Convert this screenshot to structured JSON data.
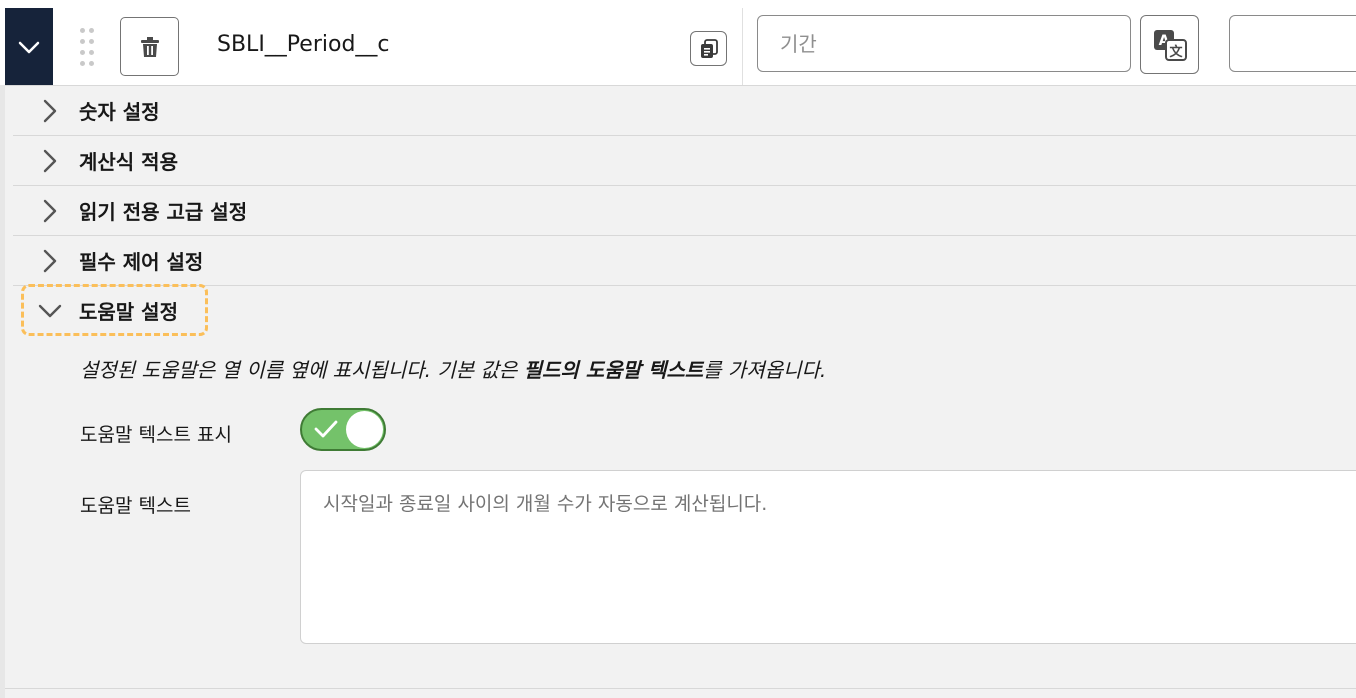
{
  "field": {
    "api_name": "SBLI__Period__c",
    "label_placeholder": "기간"
  },
  "sections": [
    {
      "title": "숫자 설정",
      "expanded": false
    },
    {
      "title": "계산식 적용",
      "expanded": false
    },
    {
      "title": "읽기 전용 고급 설정",
      "expanded": false
    },
    {
      "title": "필수 제어 설정",
      "expanded": false
    },
    {
      "title": "도움말 설정",
      "expanded": true
    }
  ],
  "help": {
    "description_before": "설정된 도움말은 열 이름 옆에 표시됩니다. 기본 값은 ",
    "description_bold": "필드의 도움말 텍스트",
    "description_after": "를 가져옵니다.",
    "show_label": "도움말 텍스트 표시",
    "show_enabled": true,
    "text_label": "도움말 텍스트",
    "text_placeholder": "시작일과 종료일 사이의 개월 수가 자동으로 계산됩니다."
  },
  "colors": {
    "expand_button": "#16233a",
    "toggle_on": "#74c26a",
    "focus_ring": "#fbbf5a"
  },
  "icons": {
    "expand": "chevron-down-icon",
    "drag": "drag-handle-icon",
    "delete": "trash-icon",
    "copy": "copy-icon",
    "translate": "translate-icon",
    "collapsed": "chevron-right-icon",
    "toggle_on": "check-icon"
  }
}
